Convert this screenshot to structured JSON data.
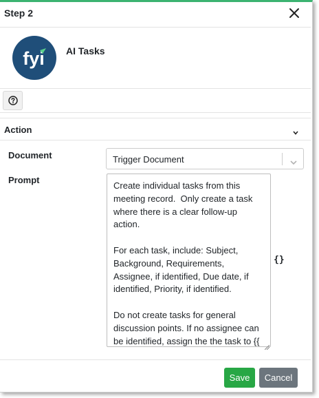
{
  "dialog": {
    "title": "Step 2",
    "close_icon": "close-icon"
  },
  "integration": {
    "logo_text": "fyi",
    "logo_icon": "fyi-logo",
    "name": "AI Tasks"
  },
  "help": {
    "icon": "question-circle-icon"
  },
  "action_section": {
    "title": "Action",
    "chevron_icon": "chevron-down-icon"
  },
  "fields": {
    "document_label": "Document",
    "document_value": "Trigger Document",
    "prompt_label": "Prompt",
    "prompt_value": "Create individual tasks from this meeting record.  Only create a task where there is a clear follow-up action.\n\nFor each task, include: Subject, Background, Requirements, Assignee, if identified, Due date, if identified, Priority, if identified.\n\nDo not create tasks for general discussion points. If no assignee can be identified, assign the the task to {{ ExecutionInitiatorUserName }}.",
    "variable_button": "{}"
  },
  "footer": {
    "save_label": "Save",
    "cancel_label": "Cancel"
  },
  "colors": {
    "accent": "#3cb371",
    "logo_bg": "#1f4e79",
    "save": "#28a745",
    "cancel": "#6c757d"
  }
}
